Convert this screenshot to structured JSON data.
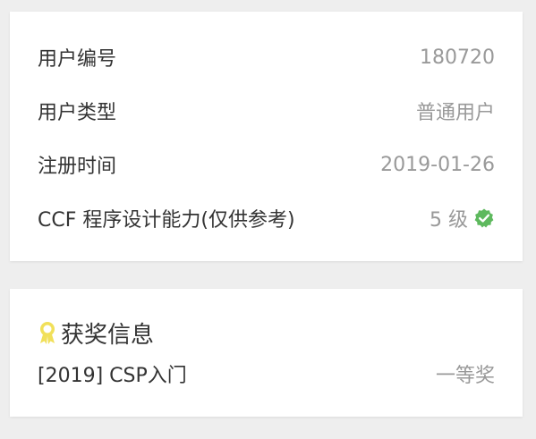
{
  "profile": {
    "rows": [
      {
        "label": "用户编号",
        "value": "180720"
      },
      {
        "label": "用户类型",
        "value": "普通用户"
      },
      {
        "label": "注册时间",
        "value": "2019-01-26"
      },
      {
        "label": "CCF 程序设计能力(仅供参考)",
        "value": "5 级"
      }
    ],
    "verified_icon": "verified-check-icon",
    "verified_color": "#5eb95e"
  },
  "awards": {
    "title": "获奖信息",
    "icon": "award-ribbon-icon",
    "icon_color": "#f1e05a",
    "items": [
      {
        "name": "[2019] CSP入门",
        "prize": "一等奖"
      }
    ]
  },
  "colors": {
    "background": "#eeeeee",
    "card": "#ffffff",
    "label_text": "#333333",
    "value_text": "#999999"
  }
}
